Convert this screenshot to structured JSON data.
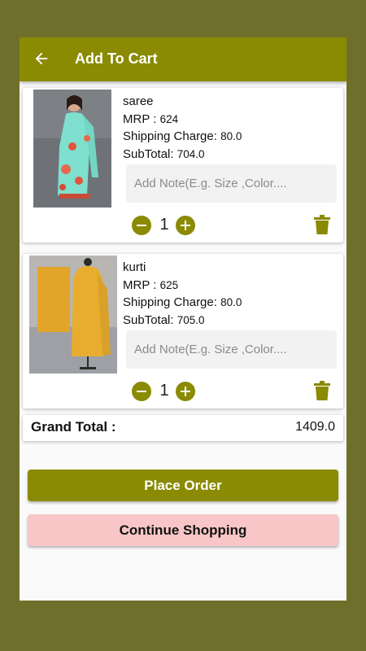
{
  "colors": {
    "primary": "#8a8a03",
    "secondary_button": "#f8c6c6",
    "frame": "#6f6f2c"
  },
  "appbar": {
    "title": "Add To Cart",
    "back_icon": "arrow-left-icon"
  },
  "items": [
    {
      "name": "saree",
      "mrp_label": "MRP :",
      "mrp": "624",
      "shipping_label": "Shipping Charge:",
      "shipping": "80.0",
      "subtotal_label": "SubTotal:",
      "subtotal": "704.0",
      "note_placeholder": "Add Note(E.g. Size ,Color....",
      "quantity": "1",
      "image": "saree-photo"
    },
    {
      "name": "kurti",
      "mrp_label": "MRP :",
      "mrp": "625",
      "shipping_label": "Shipping Charge:",
      "shipping": "80.0",
      "subtotal_label": "SubTotal:",
      "subtotal": "705.0",
      "note_placeholder": "Add Note(E.g. Size ,Color....",
      "quantity": "1",
      "image": "kurti-photo"
    }
  ],
  "grand_total": {
    "label": "Grand Total :",
    "value": "1409.0"
  },
  "buttons": {
    "place_order": "Place Order",
    "continue_shopping": "Continue Shopping"
  }
}
